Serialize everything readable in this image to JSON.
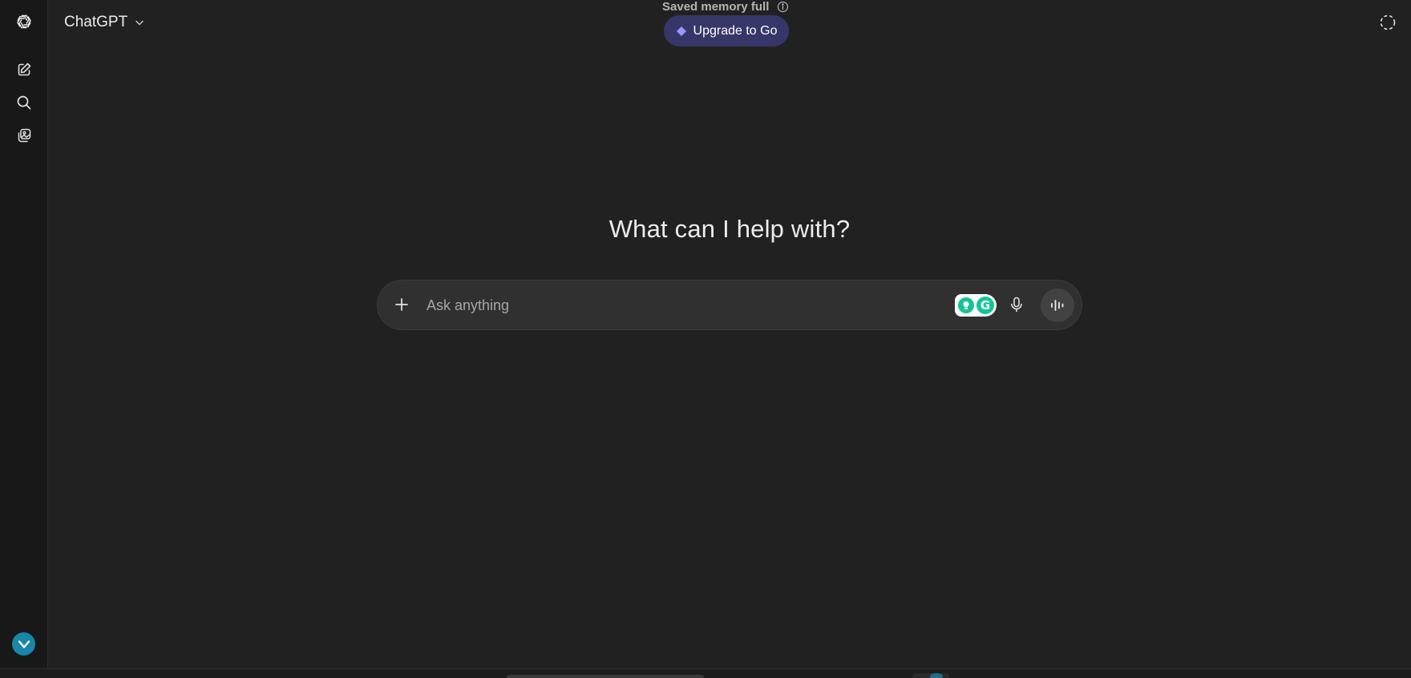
{
  "app": {
    "model_name": "ChatGPT"
  },
  "sidebar": {
    "items": [
      {
        "name": "new-chat",
        "icon": "edit-icon"
      },
      {
        "name": "search-chats",
        "icon": "search-icon"
      },
      {
        "name": "library",
        "icon": "images-icon"
      }
    ]
  },
  "banner": {
    "memory_text": "Saved memory full",
    "upgrade_label": "Upgrade to Go"
  },
  "main": {
    "headline": "What can I help with?",
    "composer": {
      "placeholder": "Ask anything"
    }
  },
  "colors": {
    "background": "#212121",
    "rail": "#181818",
    "composer": "#303030",
    "upgrade_button": "#373669",
    "grammarly_green": "#15c39a"
  }
}
